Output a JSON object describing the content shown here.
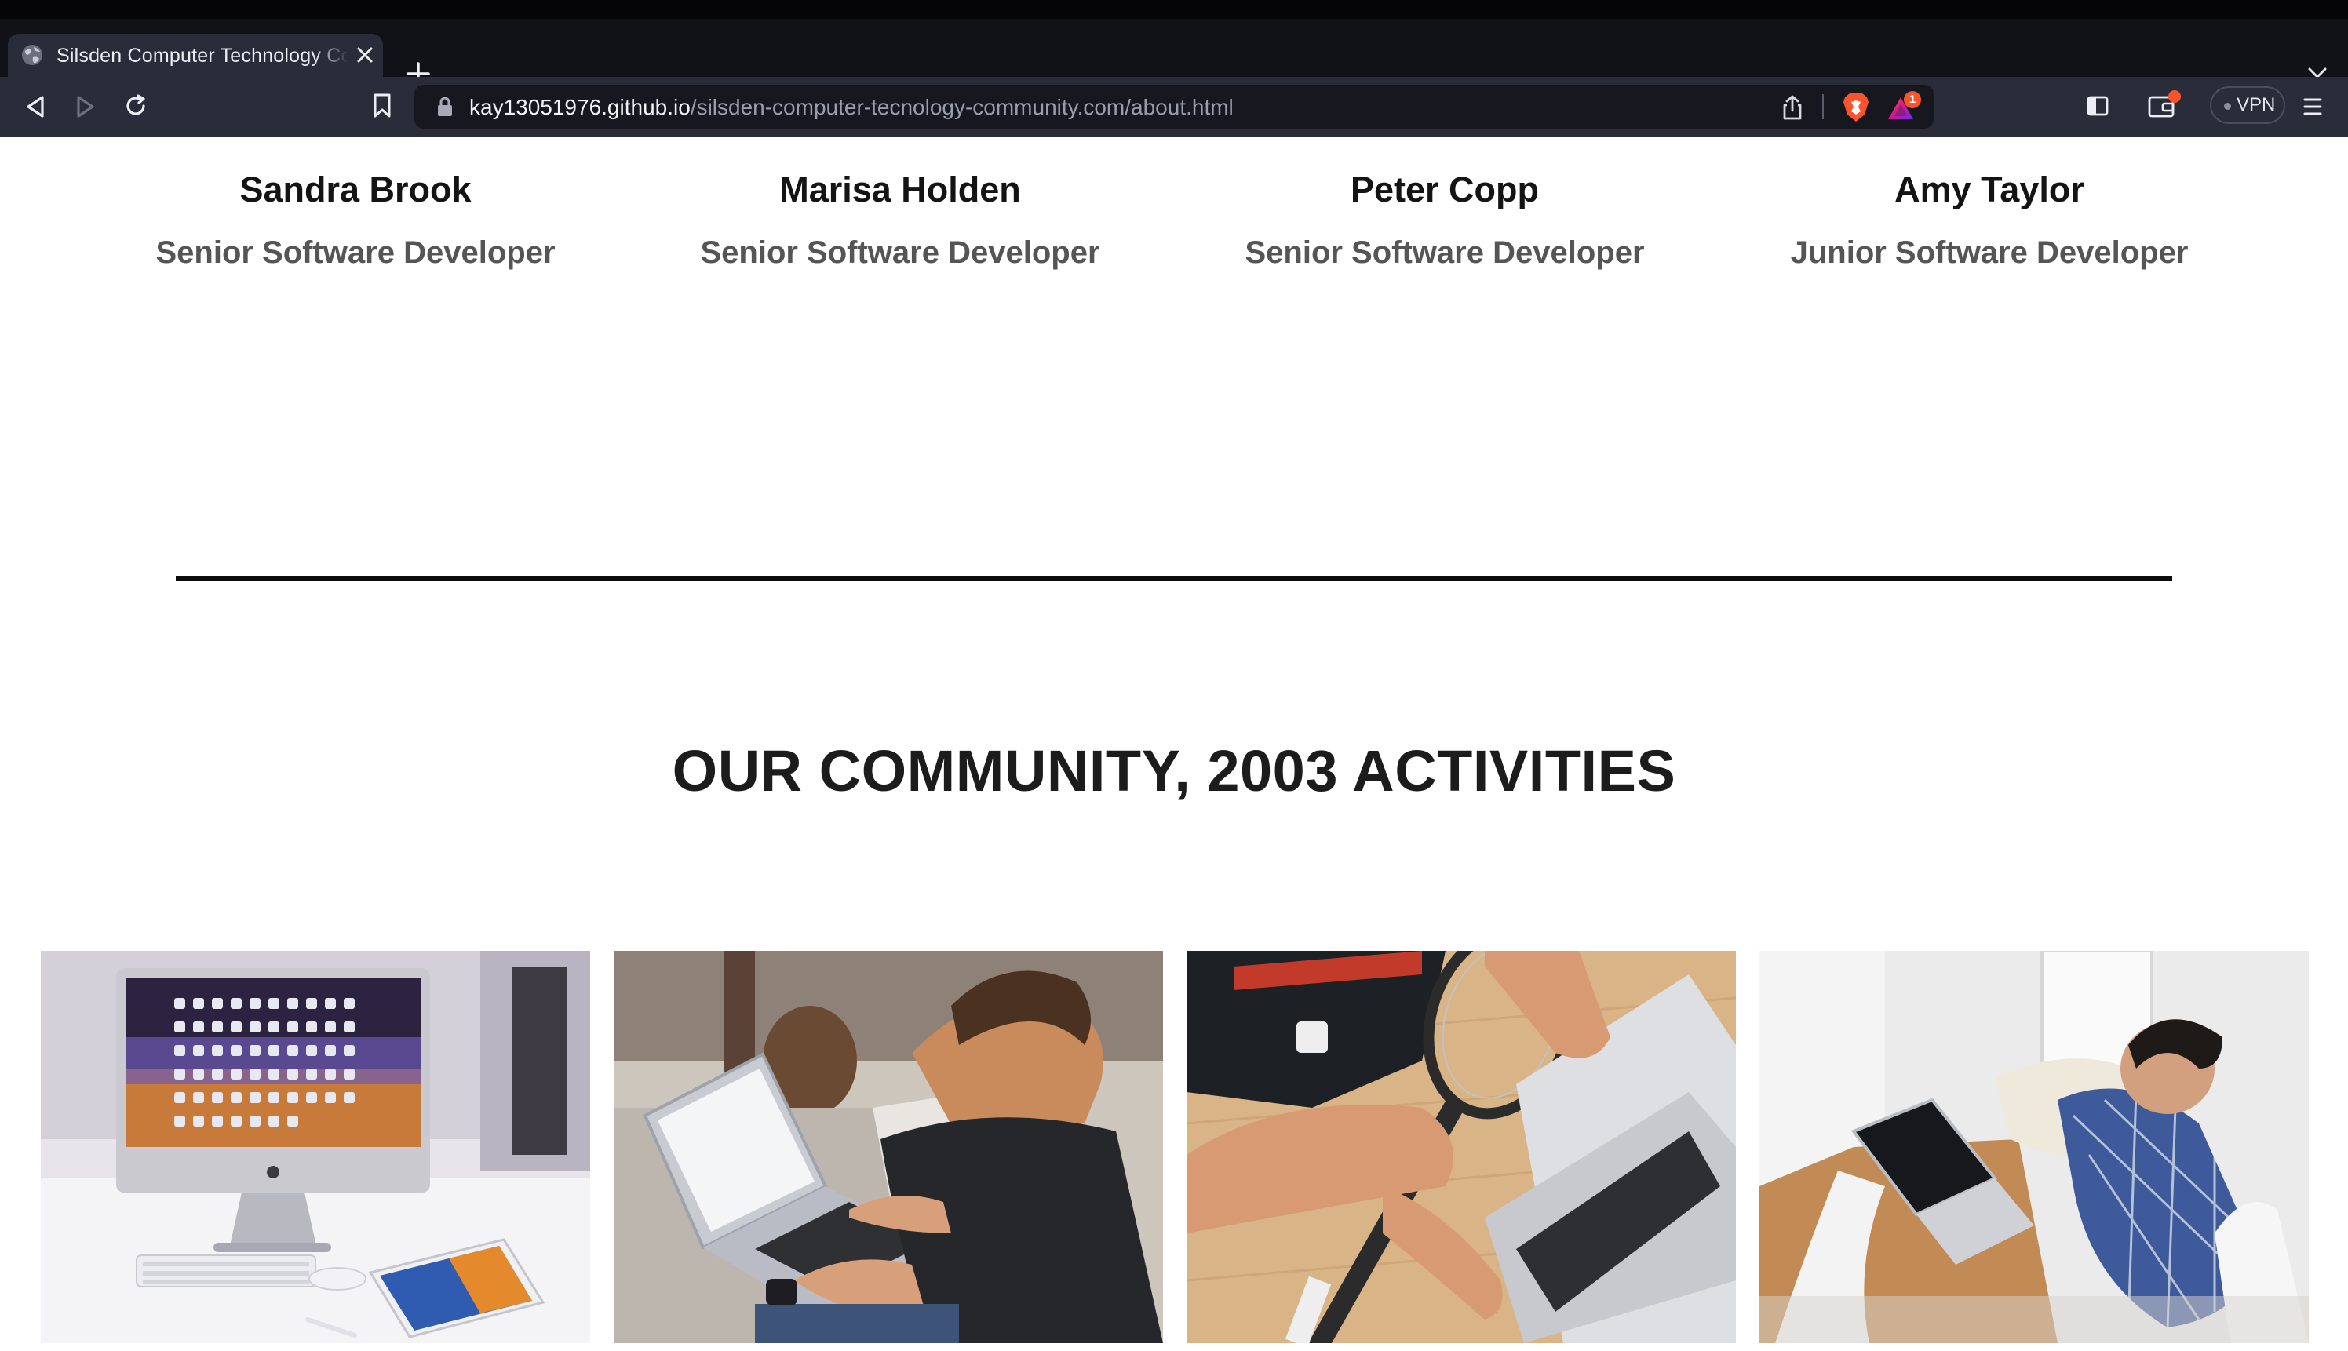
{
  "browser": {
    "tab": {
      "title": "Silsden Computer Technology Community"
    },
    "address_bar": {
      "host": "kay13051976.github.io",
      "path": "/silsden-computer-tecnology-community.com/about.html"
    },
    "rewards_badge": "1",
    "vpn_label": "VPN",
    "icons": [
      "globe-icon",
      "close-icon",
      "plus-icon",
      "chevron-down-icon",
      "back-icon",
      "forward-icon",
      "reload-icon",
      "bookmark-icon",
      "lock-icon",
      "share-icon",
      "brave-shields-icon",
      "brave-rewards-icon",
      "sidebar-icon",
      "wallet-icon",
      "menu-icon"
    ]
  },
  "team": {
    "members": [
      {
        "name": "Sandra Brook",
        "role": "Senior Software Developer"
      },
      {
        "name": "Marisa Holden",
        "role": "Senior Software Developer"
      },
      {
        "name": "Peter Copp",
        "role": "Senior Software Developer"
      },
      {
        "name": "Amy Taylor",
        "role": "Junior Software Developer"
      }
    ]
  },
  "community": {
    "heading": "OUR COMMUNITY, 2003 ACTIVITIES"
  },
  "colors": {
    "tab_active": "#292c39",
    "toolbar": "#292c39",
    "tabbar": "#111118",
    "urlbar": "#17181f",
    "brave_orange": "#fb542b",
    "heading_text": "#1c1c1c",
    "role_text": "#555555"
  }
}
